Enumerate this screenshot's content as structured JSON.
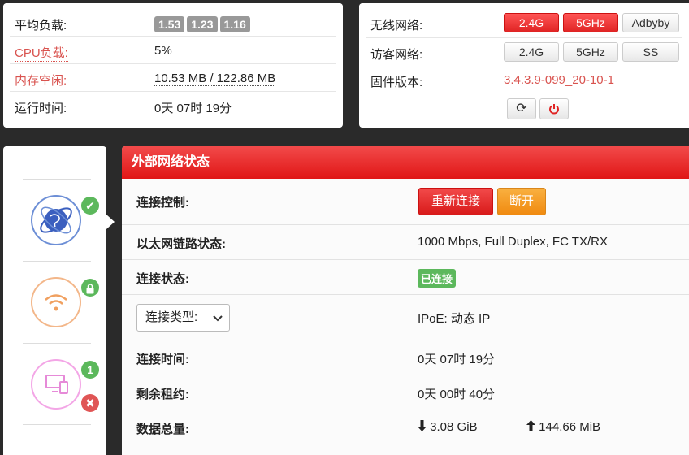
{
  "stats": {
    "load_label": "平均负载:",
    "load_values": [
      "1.53",
      "1.23",
      "1.16"
    ],
    "cpu_label": "CPU负载:",
    "cpu_value": "5%",
    "mem_label": "内存空闲:",
    "mem_value": "10.53 MB / 122.86 MB",
    "uptime_label": "运行时间:",
    "uptime_value": "0天 07时 19分"
  },
  "wifi": {
    "wireless_label": "无线网络:",
    "wireless_buttons": [
      "2.4G",
      "5GHz",
      "Adbyby"
    ],
    "guest_label": "访客网络:",
    "guest_buttons": [
      "2.4G",
      "5GHz",
      "SS"
    ],
    "firmware_label": "固件版本:",
    "firmware_value": "3.4.3.9-099_20-10-1",
    "icons": [
      "refresh-icon",
      "power-icon"
    ]
  },
  "nav": {
    "items": [
      {
        "icon": "globe-icon",
        "badge": "✔",
        "badge_color": "#5cb85c"
      },
      {
        "icon": "wifi-icon",
        "badge": "lock",
        "badge_color": "#5cb85c"
      },
      {
        "icon": "devices-icon",
        "badge": "1",
        "badge_color": "#5cb85c",
        "badge2": "✖",
        "badge2_color": "#e05555"
      }
    ]
  },
  "wan": {
    "title": "外部网络状态",
    "control_label": "连接控制:",
    "reconnect_label": "重新连接",
    "disconnect_label": "断开",
    "link_label": "以太网链路状态:",
    "link_value": "1000 Mbps, Full Duplex, FC TX/RX",
    "status_label": "连接状态:",
    "status_value": "已连接",
    "type_select": "连接类型:",
    "type_value": "IPoE: 动态 IP",
    "conn_time_label": "连接时间:",
    "conn_time_value": "0天 07时 19分",
    "lease_label": "剩余租约:",
    "lease_value": "0天 00时 40分",
    "traffic_label": "数据总量:",
    "download_value": "3.08 GiB",
    "upload_value": "144.66 MiB"
  },
  "colors": {
    "accent_red": "#e52222",
    "orange": "#f5a623",
    "green": "#5cb85c"
  }
}
